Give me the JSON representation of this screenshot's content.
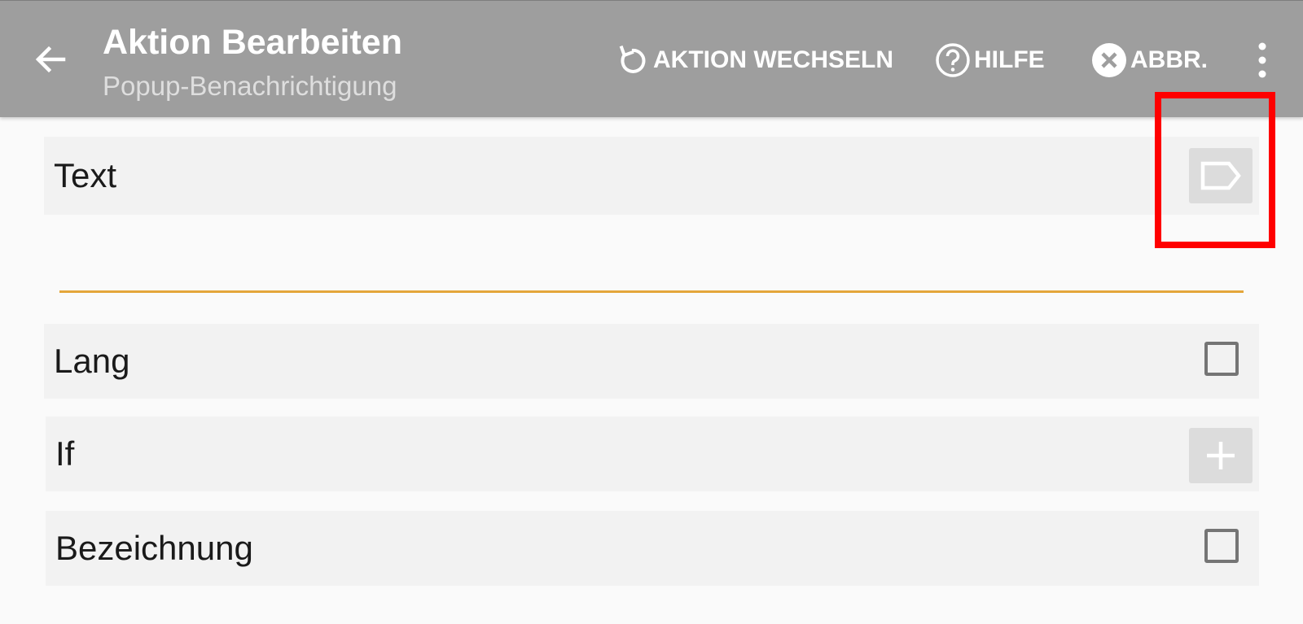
{
  "toolbar": {
    "title": "Aktion Bearbeiten",
    "subtitle": "Popup-Benachrichtigung",
    "back_icon": "arrow-left-icon",
    "actions": [
      {
        "label": "AKTION WECHSELN",
        "icon": "refresh-icon"
      },
      {
        "label": "HILFE",
        "icon": "help-circle-icon"
      },
      {
        "label": "ABBR.",
        "icon": "close-circle-icon"
      }
    ],
    "more_icon": "more-vert-icon"
  },
  "form": {
    "text": {
      "label": "Text",
      "value": "",
      "icon": "label-tag-icon"
    },
    "lang": {
      "label": "Lang",
      "checked": false
    },
    "if": {
      "label": "If",
      "icon": "plus-icon"
    },
    "bezeichnung": {
      "label": "Bezeichnung",
      "checked": false
    }
  },
  "colors": {
    "toolbar_bg": "#9e9e9e",
    "accent_underline": "#e4a63a",
    "highlight": "#ff0000"
  }
}
